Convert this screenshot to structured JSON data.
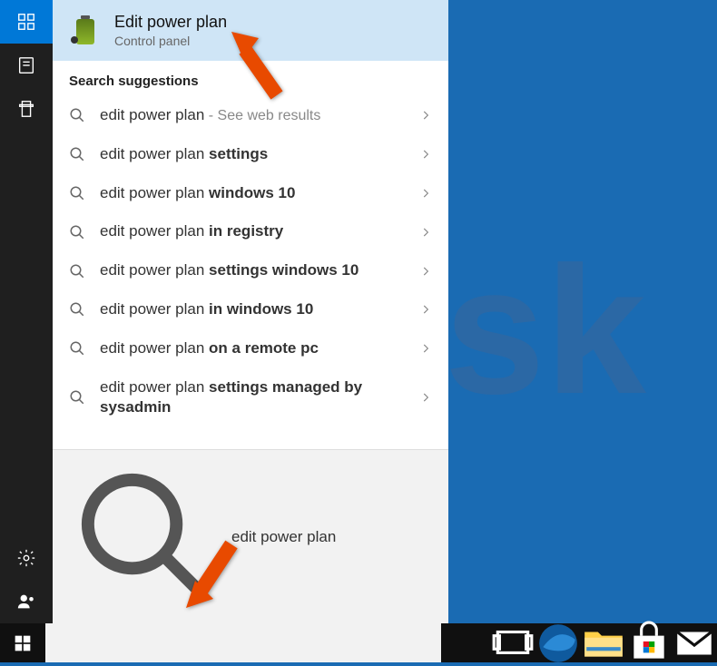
{
  "best_match": {
    "title": "Edit power plan",
    "subtitle": "Control panel"
  },
  "section_header": "Search suggestions",
  "suggestions": [
    {
      "match": "edit power plan",
      "complete": "",
      "hint": " - See web results"
    },
    {
      "match": "edit power plan ",
      "complete": "settings",
      "hint": ""
    },
    {
      "match": "edit power plan ",
      "complete": "windows 10",
      "hint": ""
    },
    {
      "match": "edit power plan ",
      "complete": "in registry",
      "hint": ""
    },
    {
      "match": "edit power plan ",
      "complete": "settings windows 10",
      "hint": ""
    },
    {
      "match": "edit power plan ",
      "complete": "in windows 10",
      "hint": ""
    },
    {
      "match": "edit power plan ",
      "complete": "on a remote pc",
      "hint": ""
    },
    {
      "match": "edit power plan ",
      "complete": "settings managed by sysadmin",
      "hint": ""
    }
  ],
  "search_value": "edit power plan",
  "watermark": "PCrisk"
}
